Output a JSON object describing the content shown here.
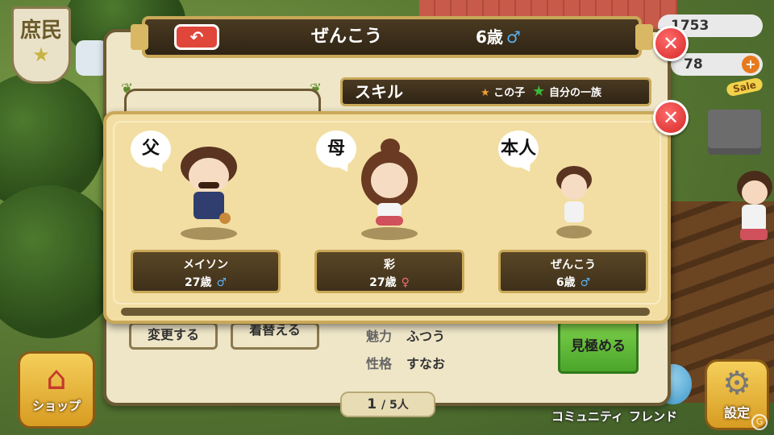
{
  "hud": {
    "rank": "庶民",
    "resource_1": "1753",
    "resource_2": "78",
    "plus": "+",
    "sale": "Sale"
  },
  "bottom_nav": {
    "shop": "ショップ",
    "community": "コミュニティ",
    "friend": "フレンド",
    "settings": "設定"
  },
  "panel": {
    "back_icon": "undo-arrow-icon",
    "title_name": "ぜんこう",
    "title_age": "6歳",
    "title_gender": "♂",
    "close": "✕",
    "skill_title": "スキル",
    "skill_legend_child": "この子",
    "skill_legend_clan": "自分の一族",
    "change_button": "変更する",
    "wear_button": "着替える",
    "attributes": [
      {
        "key": "魅力",
        "value": "ふつう"
      },
      {
        "key": "性格",
        "value": "すなお"
      }
    ],
    "judge_button": "見極める",
    "page_current": "1",
    "page_total": "/ 5人"
  },
  "family": {
    "close": "✕",
    "members": [
      {
        "role": "父",
        "name": "メイソン",
        "age": "27歳",
        "gender": "♂"
      },
      {
        "role": "母",
        "name": "彩",
        "age": "27歳",
        "gender": "♀"
      },
      {
        "role": "本人",
        "name": "ぜんこう",
        "age": "6歳",
        "gender": "♂"
      }
    ]
  },
  "colors": {
    "male": "#5ab0f0",
    "female": "#f06a74",
    "close_red": "#d62828",
    "panel_bg": "#efe6c8",
    "popup_bg": "#f2dea2",
    "bar_dark": "#3e301a",
    "gold_border": "#c9a858",
    "judge_green": "#4aa52a"
  }
}
